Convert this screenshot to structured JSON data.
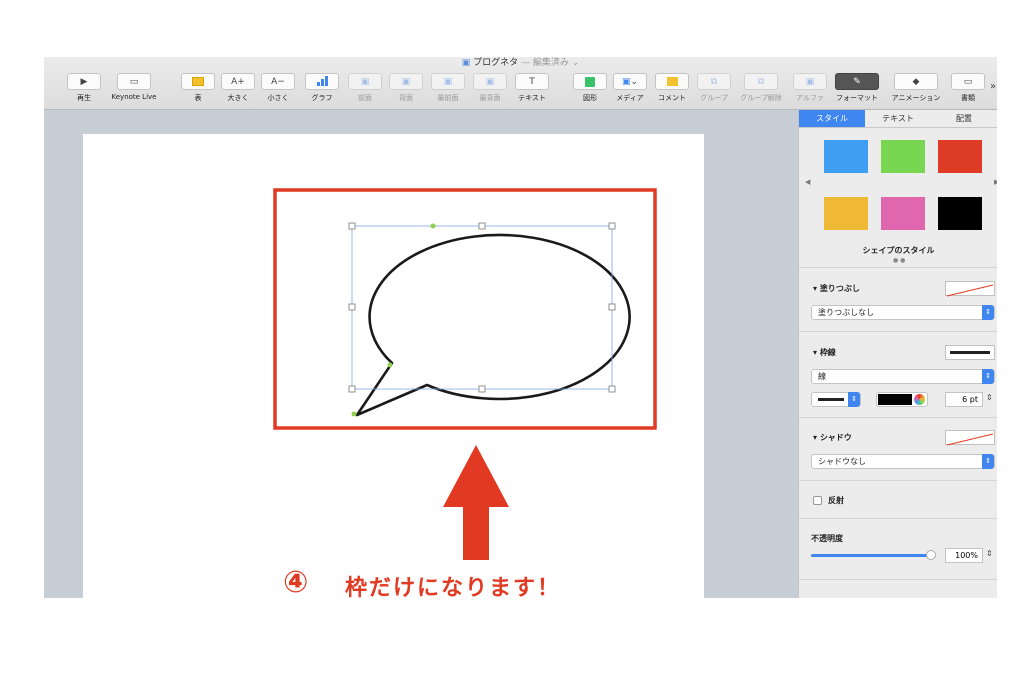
{
  "window": {
    "title": "プログネタ",
    "status": "— 編集済み ⌄"
  },
  "toolbar": {
    "play": "再生",
    "keynote_live": "Keynote Live",
    "table": "表",
    "bigger": "大きく",
    "smaller": "小さく",
    "chart": "グラフ",
    "front": "前面",
    "back": "背面",
    "frontmost": "最前面",
    "backmost": "最背面",
    "text": "テキスト",
    "shape": "図形",
    "media": "メディア",
    "comment": "コメント",
    "group": "グループ",
    "ungroup": "グループ解除",
    "alpha": "アルファ",
    "format": "フォーマット",
    "animate": "アニメーション",
    "document": "書類",
    "bigger_icon": "A+",
    "smaller_icon": "A−",
    "text_icon": "T",
    "more": "»"
  },
  "panel": {
    "tabs": [
      "スタイル",
      "テキスト",
      "配置"
    ],
    "swatch_colors": [
      "#3d9ef2",
      "#79d651",
      "#df3c26",
      "#f0b935",
      "#e066ad",
      "#000000"
    ],
    "shape_styles_label": "シェイプのスタイル",
    "fill": {
      "title": "塗りつぶし",
      "value": "塗りつぶしなし"
    },
    "border": {
      "title": "枠線",
      "value": "線",
      "width": "6 pt"
    },
    "shadow": {
      "title": "シャドウ",
      "value": "シャドウなし"
    },
    "reflection": {
      "title": "反射"
    },
    "opacity": {
      "title": "不透明度",
      "value": "100%",
      "level": 1.0
    }
  },
  "annotation": {
    "number": "④",
    "text": "枠だけになります！",
    "color": "#e23a22"
  }
}
